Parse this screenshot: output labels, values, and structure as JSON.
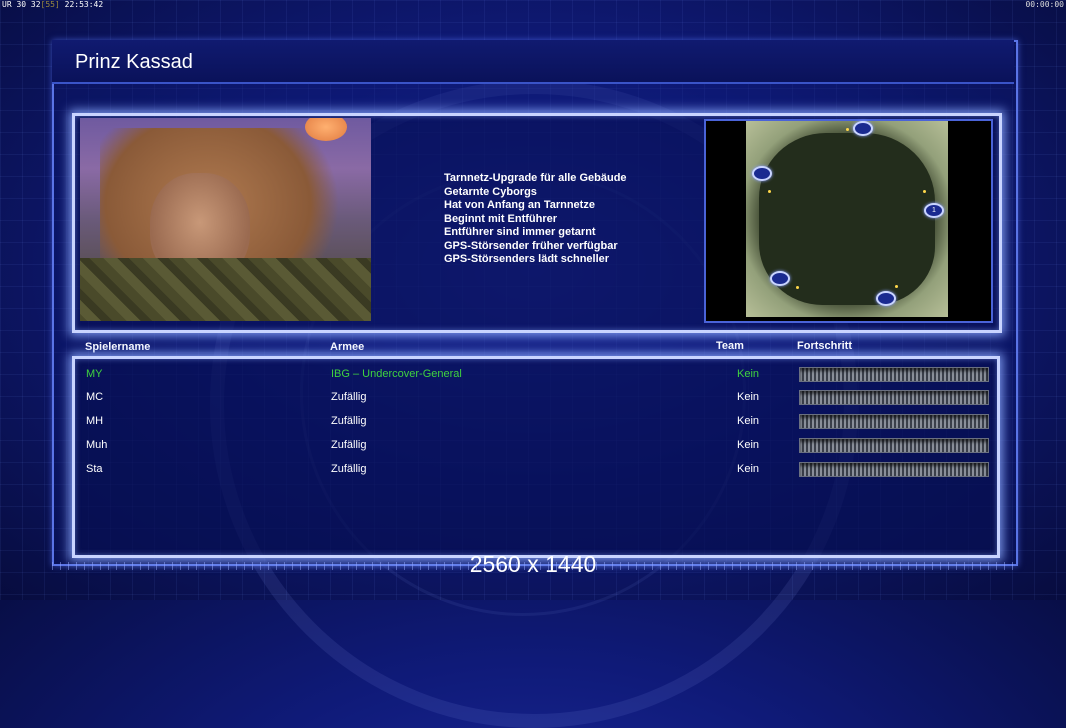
{
  "hud": {
    "left_prefix": "UR 30 32",
    "left_dim": "[55]",
    "left_time": "22:53:42",
    "right_time": "00:00:00"
  },
  "general": {
    "name": "Prinz Kassad",
    "features": [
      "Tarnnetz-Upgrade für alle Gebäude",
      "Getarnte Cyborgs",
      "Hat von Anfang an Tarnnetze",
      "Beginnt mit Entführer",
      "Entführer sind immer getarnt",
      "GPS-Störsender früher verfügbar",
      "GPS-Störsenders lädt schneller"
    ]
  },
  "minimap": {
    "slot_label": "1"
  },
  "table": {
    "headers": {
      "player": "Spielername",
      "army": "Armee",
      "team": "Team",
      "progress": "Fortschritt"
    },
    "rows": [
      {
        "player": "MY",
        "army": "IBG – Undercover-General",
        "team": "Kein",
        "highlight": true,
        "progress": 0
      },
      {
        "player": "MC",
        "army": "Zufällig",
        "team": "Kein",
        "highlight": false,
        "progress": 0
      },
      {
        "player": "MH",
        "army": "Zufällig",
        "team": "Kein",
        "highlight": false,
        "progress": 0
      },
      {
        "player": "Muh",
        "army": "Zufällig",
        "team": "Kein",
        "highlight": false,
        "progress": 0
      },
      {
        "player": "Sta",
        "army": "Zufällig",
        "team": "Kein",
        "highlight": false,
        "progress": 0
      }
    ]
  },
  "colors": {
    "highlight": "#3fd23f",
    "normal": "#ffffff",
    "accent": "#c9d4ff"
  },
  "resolution_label": "2560 x 1440"
}
